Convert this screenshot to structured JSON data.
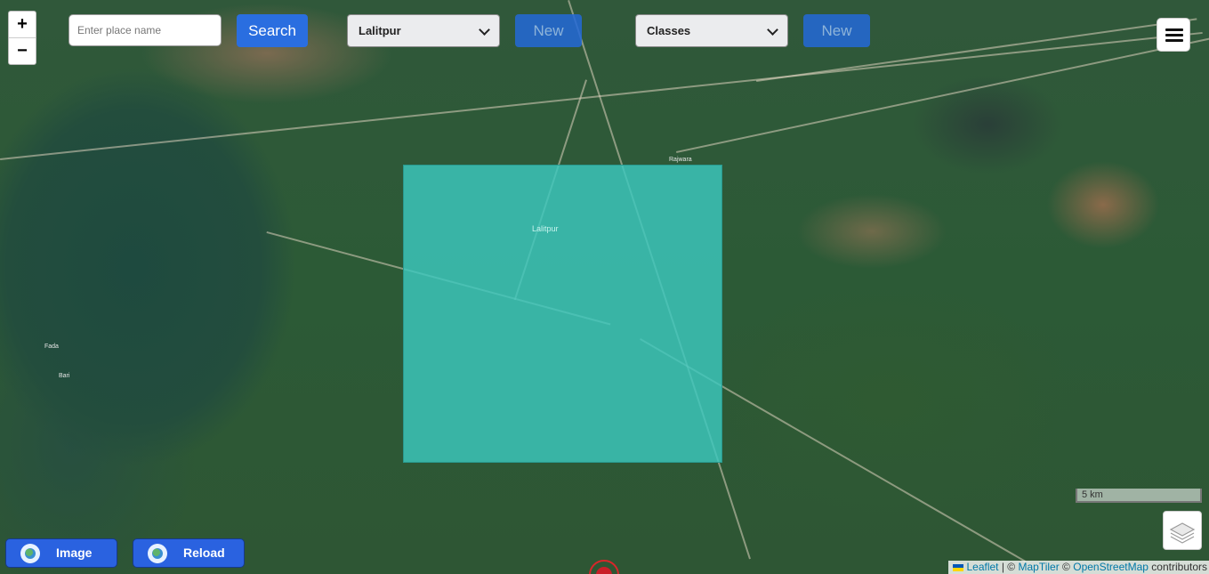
{
  "toolbar": {
    "search_placeholder": "Enter place name",
    "search_label": "Search",
    "district_select": "Lalitpur",
    "new_label_1": "New",
    "classes_select": "Classes",
    "new_label_2": "New"
  },
  "zoom": {
    "in": "+",
    "out": "−"
  },
  "map": {
    "overlay_place_label": "Lalitpur",
    "village_labels": [
      "Rajwara",
      "Fada",
      "Bari"
    ],
    "overlay_color": "#3cc8be"
  },
  "scale": {
    "label": "5 km"
  },
  "attribution": {
    "leaflet": "Leaflet",
    "maptiler": "MapTiler",
    "osm": "OpenStreetMap",
    "suffix": "contributors"
  },
  "bottom_buttons": {
    "image": "Image",
    "reload": "Reload"
  },
  "icons": [
    "menu-icon",
    "layers-icon",
    "globe-icon",
    "location-marker-icon",
    "chevron-down-icon"
  ]
}
